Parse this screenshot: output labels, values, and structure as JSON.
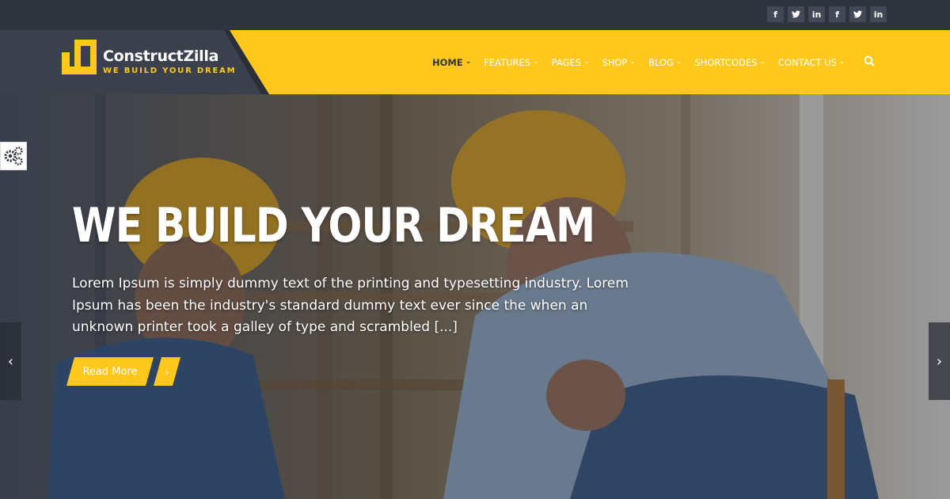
{
  "colors": {
    "accent": "#ffc81b",
    "dark": "#30343f",
    "panel": "#3b404d"
  },
  "social": [
    {
      "name": "facebook-icon",
      "glyph": "f"
    },
    {
      "name": "twitter-icon",
      "glyph": "t"
    },
    {
      "name": "linkedin-icon",
      "glyph": "in"
    },
    {
      "name": "facebook-icon",
      "glyph": "f"
    },
    {
      "name": "twitter-icon",
      "glyph": "t"
    },
    {
      "name": "linkedin-icon",
      "glyph": "in"
    }
  ],
  "brand": {
    "name": "ConstructZilla",
    "tagline": "WE BUILD YOUR DREAM"
  },
  "nav": [
    {
      "label": "HOME",
      "active": true
    },
    {
      "label": "FEATURES"
    },
    {
      "label": "PAGES"
    },
    {
      "label": "SHOP"
    },
    {
      "label": "BLOG"
    },
    {
      "label": "SHORTCODES"
    },
    {
      "label": "CONTACT US"
    }
  ],
  "hero": {
    "title": "WE BUILD YOUR DREAM",
    "text": "Lorem Ipsum is simply dummy text of the printing and typesetting industry. Lorem Ipsum has been the industry's standard dummy text ever since the when an unknown printer took a galley of type and scrambled [...]",
    "button_label": "Read More",
    "button_arrow": "›",
    "prev": "‹",
    "next": "›"
  },
  "icons": {
    "settings": "gears-icon",
    "search": "search-icon"
  }
}
